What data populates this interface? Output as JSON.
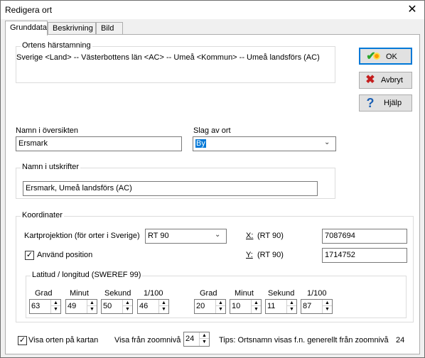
{
  "window": {
    "title": "Redigera ort"
  },
  "tabs": [
    {
      "label": "Grunddata"
    },
    {
      "label": "Beskrivning"
    },
    {
      "label": "Bild"
    }
  ],
  "origin": {
    "legend": "Ortens härstamning",
    "text": "Sverige <Land> -- Västerbottens län <AC> -- Umeå <Kommun> -- Umeå landsförs (AC)"
  },
  "buttons": {
    "ok": "OK",
    "cancel": "Avbryt",
    "help": "Hjälp"
  },
  "overview": {
    "label": "Namn i översikten",
    "value": "Ersmark"
  },
  "kind": {
    "label": "Slag av ort",
    "value": "By"
  },
  "print": {
    "legend": "Namn i utskrifter",
    "value": "Ersmark, Umeå landsförs (AC)"
  },
  "coords": {
    "legend": "Koordinater",
    "projection_label": "Kartprojektion (för orter i Sverige)",
    "projection_value": "RT 90",
    "x_label": "X:",
    "x_unit": "(RT 90)",
    "x_value": "7087694",
    "y_label": "Y:",
    "y_unit": "(RT 90)",
    "y_value": "1714752",
    "use_position_label": "Använd position",
    "use_position_checked": true
  },
  "latlong": {
    "legend": "Latitud / longitud (SWEREF 99)",
    "headers": [
      "Grad",
      "Minut",
      "Sekund",
      "1/100"
    ],
    "lat": [
      "63",
      "49",
      "50",
      "46"
    ],
    "lon": [
      "20",
      "10",
      "11",
      "87"
    ]
  },
  "footer": {
    "show_on_map_label": "Visa orten på kartan",
    "show_on_map_checked": true,
    "zoom_label": "Visa från zoomnivå",
    "zoom_value": "24",
    "tip": "Tips: Ortsnamn visas f.n. generellt från  zoomnivå",
    "tip_value": "24"
  }
}
